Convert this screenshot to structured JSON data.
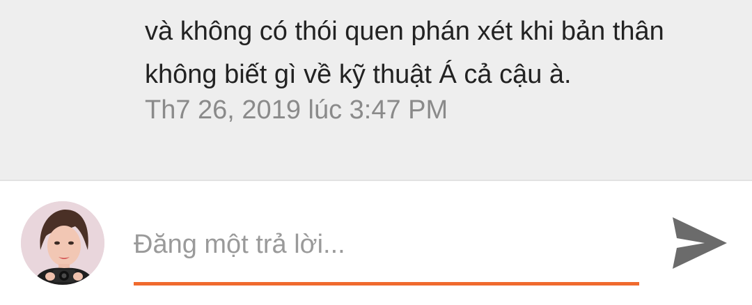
{
  "comment": {
    "text_lines": [
      "và không có thói quen phán xét khi bản thân",
      "không biết gì về kỹ thuật Á cả cậu à."
    ],
    "timestamp": "Th7 26, 2019 lúc 3:47 PM"
  },
  "reply": {
    "placeholder": "Đăng một trả lời...",
    "value": "",
    "avatar_icon": "user-avatar-photo",
    "send_icon": "send-icon"
  },
  "colors": {
    "comment_bg": "#eeeeee",
    "accent_underline": "#f06a2e",
    "send_icon": "#6b6b6b",
    "timestamp": "#8a8a8a"
  }
}
